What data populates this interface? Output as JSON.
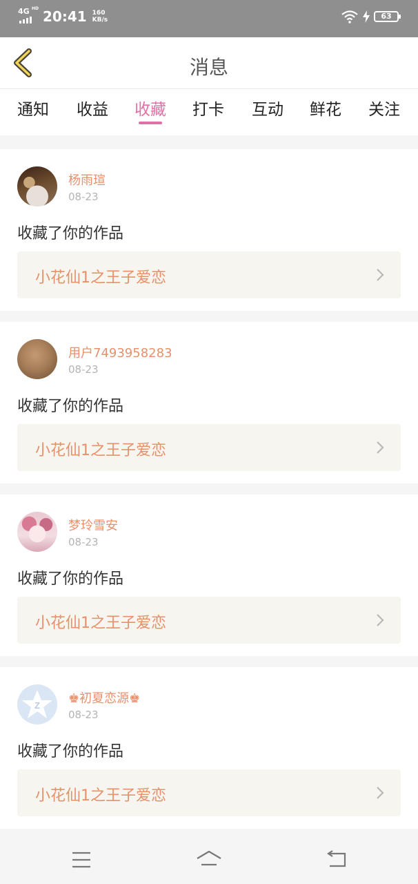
{
  "status_bar": {
    "network": "4G",
    "network_sup": "HD",
    "time": "20:41",
    "speed_value": "160",
    "speed_unit": "KB/s",
    "battery": "63"
  },
  "header": {
    "title": "消息",
    "back_icon": "chevron-left-icon"
  },
  "tabs": [
    {
      "label": "通知",
      "active": false
    },
    {
      "label": "收益",
      "active": false
    },
    {
      "label": "收藏",
      "active": true
    },
    {
      "label": "打卡",
      "active": false
    },
    {
      "label": "互动",
      "active": false
    },
    {
      "label": "鲜花",
      "active": false
    },
    {
      "label": "关注",
      "active": false
    }
  ],
  "notifications": [
    {
      "username": "杨雨瑄",
      "date": "08-23",
      "message": "收藏了你的作品",
      "work_title": "小花仙1之王子爱恋"
    },
    {
      "username": "用户7493958283",
      "date": "08-23",
      "message": "收藏了你的作品",
      "work_title": "小花仙1之王子爱恋"
    },
    {
      "username": "梦玲雪安",
      "date": "08-23",
      "message": "收藏了你的作品",
      "work_title": "小花仙1之王子爱恋"
    },
    {
      "username": "♚初夏恋源♚",
      "date": "08-23",
      "message": "收藏了你的作品",
      "work_title": "小花仙1之王子爱恋"
    }
  ],
  "colors": {
    "accent_pink": "#e171a4",
    "username_orange": "#e8906a",
    "work_bg": "#f6f5ef",
    "status_bar": "#8f8f8f"
  },
  "nav_bar": {
    "icons": [
      "menu-icon",
      "home-icon",
      "back-icon"
    ]
  }
}
